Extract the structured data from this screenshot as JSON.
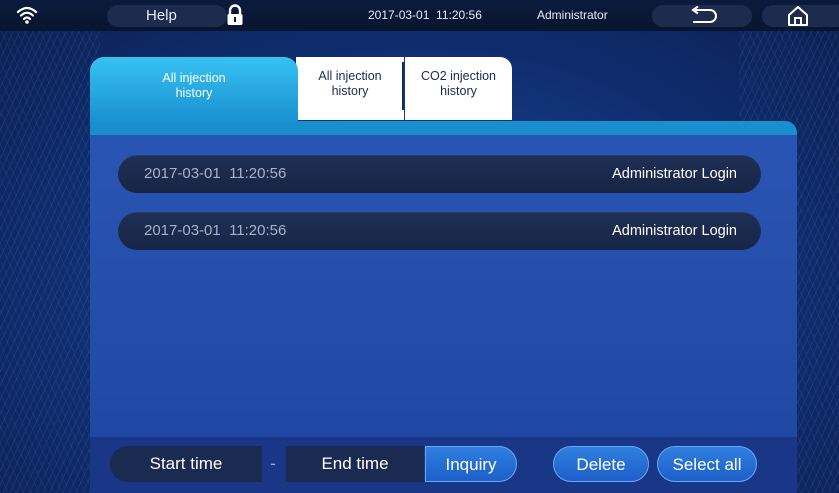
{
  "topbar": {
    "help_label": "Help",
    "datetime": "2017-03-01  11:20:56",
    "user": "Administrator"
  },
  "tabs": [
    {
      "label_line1": "All injection",
      "label_line2": "history",
      "active": true
    },
    {
      "label_line1": "All injection",
      "label_line2": "history",
      "active": false
    },
    {
      "label_line1": "CO2 injection",
      "label_line2": "history",
      "active": false
    }
  ],
  "log_rows": [
    {
      "time": "2017-03-01  11:20:56",
      "event": "Administrator Login"
    },
    {
      "time": "2017-03-01  11:20:56",
      "event": "Administrator Login"
    }
  ],
  "toolbar": {
    "start_time_label": "Start time",
    "separator": "-",
    "end_time_label": "End time",
    "inquiry_label": "Inquiry",
    "delete_label": "Delete",
    "select_all_label": "Select all"
  },
  "icons": [
    "wifi-icon",
    "lock-icon",
    "back-icon",
    "home-icon"
  ],
  "colors": {
    "active_tab": "#36c3f2",
    "inactive_tab": "#ffffff",
    "panel": "#2b55b5",
    "button": "#2f7fe0"
  }
}
